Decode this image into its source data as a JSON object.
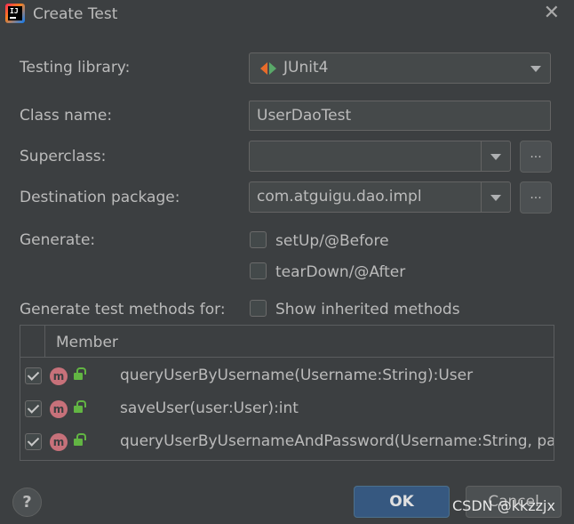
{
  "window": {
    "title": "Create Test",
    "close_label": "✕"
  },
  "form": {
    "testing_library_label": "Testing library:",
    "testing_library_value": "JUnit4",
    "class_name_label": "Class name:",
    "class_name_value": "UserDaoTest",
    "superclass_label": "Superclass:",
    "superclass_value": "",
    "destination_label": "Destination package:",
    "destination_value": "com.atguigu.dao.impl",
    "browse_label": "...",
    "generate_label": "Generate:",
    "setup_label": "setUp/@Before",
    "setup_checked": false,
    "teardown_label": "tearDown/@After",
    "teardown_checked": false,
    "methods_for_label": "Generate test methods for:",
    "inherited_label": "Show inherited methods",
    "inherited_checked": false
  },
  "table": {
    "column": "Member",
    "rows": [
      {
        "icon": "m",
        "member": "queryUserByUsername(Username:String):User",
        "checked": true
      },
      {
        "icon": "m",
        "member": "saveUser(user:User):int",
        "checked": true
      },
      {
        "icon": "m",
        "member": "queryUserByUsernameAndPassword(Username:String, pa",
        "checked": true
      }
    ]
  },
  "buttons": {
    "help": "?",
    "ok": "OK",
    "cancel": "Cancel"
  },
  "watermark": "CSDN @kkzzjx",
  "colors": {
    "background": "#3c3f41",
    "primary_button": "#365880",
    "method_icon": "#c7717a",
    "lock_icon": "#62b543"
  }
}
